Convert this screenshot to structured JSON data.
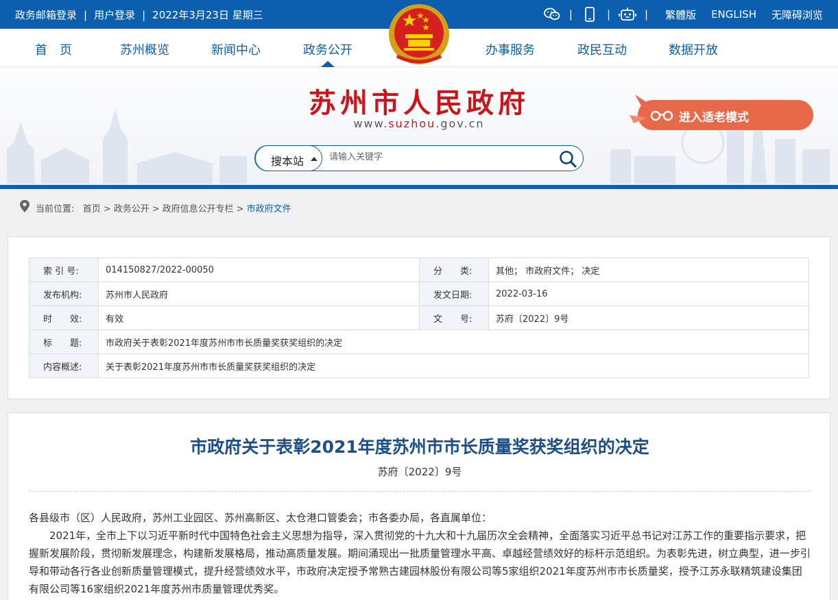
{
  "topbar": {
    "mail_login": "政务邮箱登录",
    "user_login": "用户登录",
    "date": "2022年3月23日 星期三",
    "sep": "|",
    "icons": [
      "wechat-icon",
      "mobile-icon",
      "robot-icon"
    ],
    "traditional": "繁體版",
    "english": "ENGLISH",
    "accessible": "无障碍浏览"
  },
  "nav": {
    "items": [
      "首　页",
      "苏州概览",
      "新闻中心",
      "政务公开",
      "办事服务",
      "政民互动",
      "数据开放"
    ],
    "active": "政务公开"
  },
  "banner": {
    "title": "苏州市人民政府",
    "url_prefix": "www.",
    "url_domain": "suzhou",
    "url_suffix": ".gov.cn",
    "elder_mode": "进入适老模式"
  },
  "search": {
    "scope": "搜本站",
    "placeholder": "请输入关键字"
  },
  "breadcrumb": {
    "label": "当前位置:",
    "items": [
      "首页",
      "政务公开",
      "政府信息公开专栏",
      "市政府文件"
    ]
  },
  "meta": {
    "index_no_label": "索 引 号:",
    "index_no": "014150827/2022-00050",
    "category_label": "分　　类:",
    "category": "其他；  市政府文件；  决定",
    "publisher_label": "发布机构:",
    "publisher": "苏州市人民政府",
    "date_label": "发文日期:",
    "date": "2022-03-16",
    "validity_label": "时　　效:",
    "validity": "有效",
    "docno_label": "文　　号:",
    "docno": "苏府〔2022〕9号",
    "title_label": "标　　题:",
    "title": "市政府关于表彰2021年度苏州市市长质量奖获奖组织的决定",
    "summary_label": "内容概述:",
    "summary": "关于表彰2021年度苏州市市长质量奖获奖组织的决定"
  },
  "article": {
    "title": "市政府关于表彰2021年度苏州市市长质量奖获奖组织的决定",
    "docno": "苏府〔2022〕9号",
    "salutation": "各县级市（区）人民政府，苏州工业园区、苏州高新区、太仓港口管委会；市各委办局，各直属单位：",
    "para1": "2021年，全市上下以习近平新时代中国特色社会主义思想为指导，深入贯彻党的十九大和十九届历次全会精神，全面落实习近平总书记对江苏工作的重要指示要求，把握新发展阶段，贯彻新发展理念，构建新发展格局，推动高质量发展。期间涌现出一批质量管理水平高、卓越经营绩效好的标杆示范组织。为表彰先进，树立典型，进一步引导和带动各行各业创新质量管理模式，提升经营绩效水平，市政府决定授予常熟古建园林股份有限公司等5家组织2021年度苏州市市长质量奖，授予江苏永联精筑建设集团有限公司等16家组织2021年度苏州市质量管理优秀奖。"
  },
  "colors": {
    "brand_blue": "#0b5fae",
    "title_red": "#c8161d",
    "elder_orange": "#e8684a"
  }
}
